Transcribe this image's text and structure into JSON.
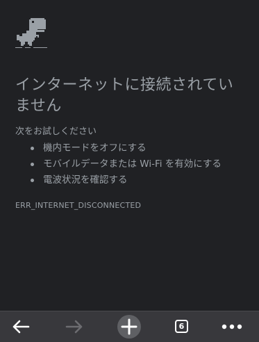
{
  "error_page": {
    "title": "インターネットに接続されていません",
    "try_label": "次をお試しください",
    "suggestions": [
      "機内モードをオフにする",
      "モバイルデータまたは Wi-Fi を有効にする",
      "電波状況を確認する"
    ],
    "error_code": "ERR_INTERNET_DISCONNECTED"
  },
  "toolbar": {
    "back_icon": "arrow-left-icon",
    "forward_icon": "arrow-right-icon",
    "new_tab_icon": "plus-icon",
    "tab_count": "6",
    "menu_icon": "more-horizontal-icon"
  },
  "colors": {
    "background": "#202124",
    "text": "#9aa0a6",
    "toolbar": "#38383c",
    "toolbar_icon": "#ffffff",
    "toolbar_icon_disabled": "#6c6c70"
  }
}
